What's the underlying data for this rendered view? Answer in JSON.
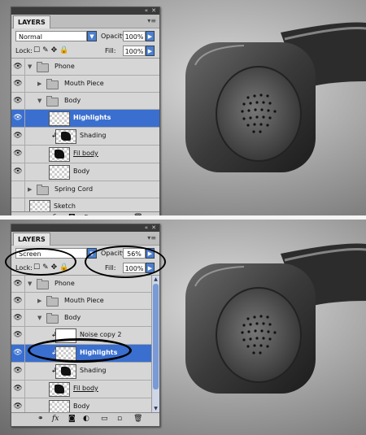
{
  "panels": [
    {
      "title": "LAYERS",
      "blend_mode": "Normal",
      "opacity_label": "Opacity:",
      "opacity": "100%",
      "lock_label": "Lock:",
      "fill_label": "Fill:",
      "fill": "100%",
      "layers": [
        {
          "name": "Phone",
          "kind": "group",
          "indent": 0,
          "expanded": true,
          "visible": true
        },
        {
          "name": "Mouth Piece",
          "kind": "group",
          "indent": 1,
          "expanded": false,
          "visible": true
        },
        {
          "name": "Body",
          "kind": "group",
          "indent": 1,
          "expanded": true,
          "visible": true
        },
        {
          "name": "Highlights",
          "kind": "layer",
          "indent": 2,
          "selected": true,
          "visible": true,
          "thumb": "checker"
        },
        {
          "name": "Shading",
          "kind": "layer",
          "indent": 2,
          "clipped": true,
          "visible": true,
          "thumb": "dark"
        },
        {
          "name": "Fil body",
          "kind": "layer",
          "indent": 2,
          "underline": true,
          "visible": true,
          "thumb": "dark"
        },
        {
          "name": "Body",
          "kind": "layer",
          "indent": 2,
          "visible": true,
          "thumb": "checker"
        },
        {
          "name": "Spring Cord",
          "kind": "group",
          "indent": 0,
          "expanded": false,
          "visible": false
        },
        {
          "name": "Sketch",
          "kind": "layer",
          "indent": 0,
          "visible": false,
          "thumb": "checker"
        }
      ]
    },
    {
      "title": "LAYERS",
      "blend_mode": "Screen",
      "opacity_label": "Opacity:",
      "opacity": "56%",
      "lock_label": "Lock:",
      "fill_label": "Fill:",
      "fill": "100%",
      "layers": [
        {
          "name": "Phone",
          "kind": "group",
          "indent": 0,
          "expanded": true,
          "visible": true
        },
        {
          "name": "Mouth Piece",
          "kind": "group",
          "indent": 1,
          "expanded": false,
          "visible": true
        },
        {
          "name": "Body",
          "kind": "group",
          "indent": 1,
          "expanded": true,
          "visible": true
        },
        {
          "name": "Noise copy 2",
          "kind": "layer",
          "indent": 2,
          "clipped": true,
          "visible": true,
          "thumb": "blank"
        },
        {
          "name": "Highlights",
          "kind": "layer",
          "indent": 2,
          "selected": true,
          "clipped": true,
          "visible": true,
          "thumb": "checker"
        },
        {
          "name": "Shading",
          "kind": "layer",
          "indent": 2,
          "clipped": true,
          "visible": true,
          "thumb": "dark"
        },
        {
          "name": "Fil body",
          "kind": "layer",
          "indent": 2,
          "underline": true,
          "visible": true,
          "thumb": "dark"
        },
        {
          "name": "Body",
          "kind": "layer",
          "indent": 2,
          "visible": true,
          "thumb": "checker"
        }
      ]
    }
  ],
  "icons": {
    "eye": "eye-icon",
    "lock_icons": [
      "lock-transparent-icon",
      "lock-brush-icon",
      "lock-move-icon",
      "lock-all-icon"
    ],
    "bottom_tools": [
      "link-layers-icon",
      "fx-icon",
      "mask-icon",
      "adjustment-icon",
      "new-group-icon",
      "new-layer-icon",
      "trash-icon"
    ]
  },
  "colors": {
    "selection": "#3a6fcf",
    "annotation": "#000000"
  }
}
